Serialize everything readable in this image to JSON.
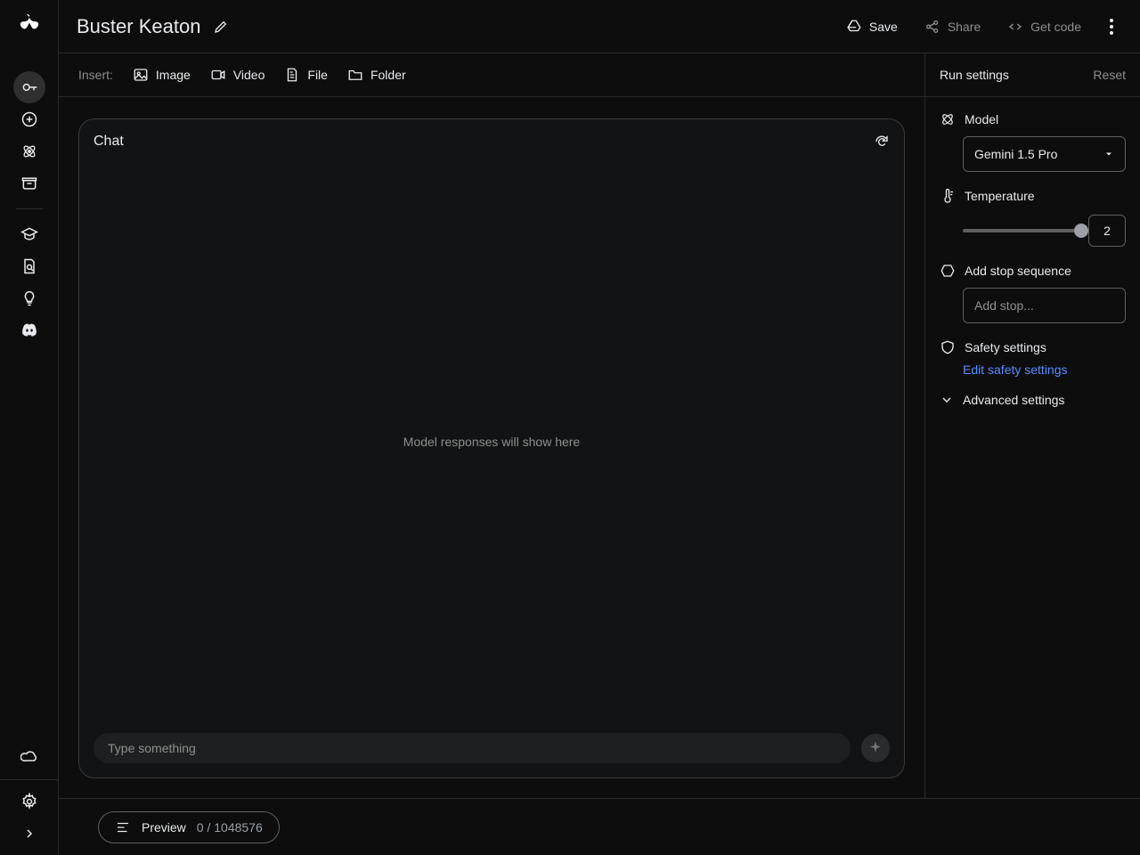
{
  "header": {
    "title": "Buster Keaton",
    "save_label": "Save",
    "share_label": "Share",
    "get_code_label": "Get code"
  },
  "insert": {
    "label": "Insert:",
    "image": "Image",
    "video": "Video",
    "file": "File",
    "folder": "Folder"
  },
  "chat": {
    "title": "Chat",
    "empty": "Model responses will show here",
    "placeholder": "Type something"
  },
  "settings": {
    "title": "Run settings",
    "reset": "Reset",
    "model_label": "Model",
    "model_selected": "Gemini 1.5 Pro",
    "temperature_label": "Temperature",
    "temperature_value": "2",
    "stop_label": "Add stop sequence",
    "stop_placeholder": "Add stop...",
    "safety_label": "Safety settings",
    "safety_edit": "Edit safety settings",
    "advanced_label": "Advanced settings"
  },
  "footer": {
    "preview_label": "Preview",
    "token_count": "0 / 1048576"
  }
}
